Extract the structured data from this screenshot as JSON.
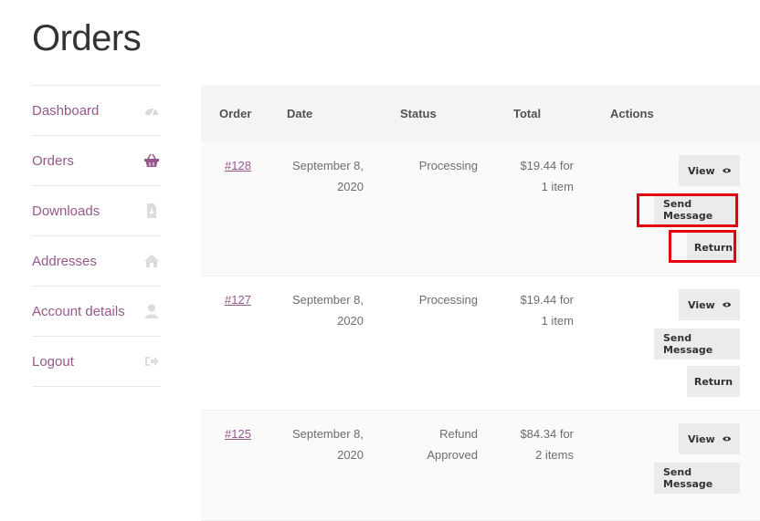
{
  "page": {
    "title": "Orders"
  },
  "nav": [
    {
      "label": "Dashboard",
      "icon": "dashboard-gauge-icon"
    },
    {
      "label": "Orders",
      "icon": "basket-icon",
      "active": true
    },
    {
      "label": "Downloads",
      "icon": "file-download-icon"
    },
    {
      "label": "Addresses",
      "icon": "home-icon"
    },
    {
      "label": "Account details",
      "icon": "user-icon"
    },
    {
      "label": "Logout",
      "icon": "sign-out-icon"
    }
  ],
  "table": {
    "headers": {
      "order": "Order",
      "date": "Date",
      "status": "Status",
      "total": "Total",
      "actions": "Actions"
    },
    "rows": [
      {
        "order": "#128",
        "date_line1": "September 8,",
        "date_line2": "2020",
        "status_line1": "Processing",
        "status_line2": "",
        "total_line1": "$19.44 for",
        "total_line2": "1 item",
        "view": "View",
        "send": "Send Message",
        "return": "Return"
      },
      {
        "order": "#127",
        "date_line1": "September 8,",
        "date_line2": "2020",
        "status_line1": "Processing",
        "status_line2": "",
        "total_line1": "$19.44 for",
        "total_line2": "1 item",
        "view": "View",
        "send": "Send Message",
        "return": "Return"
      },
      {
        "order": "#125",
        "date_line1": "September 8,",
        "date_line2": "2020",
        "status_line1": "Refund",
        "status_line2": "Approved",
        "total_line1": "$84.34 for",
        "total_line2": "2 items",
        "view": "View",
        "send": "Send Message"
      }
    ]
  },
  "colors": {
    "accent": "#96588a",
    "highlight": "#e3000f",
    "header_bg": "#f4f4f4",
    "button_bg": "#ebebeb"
  }
}
